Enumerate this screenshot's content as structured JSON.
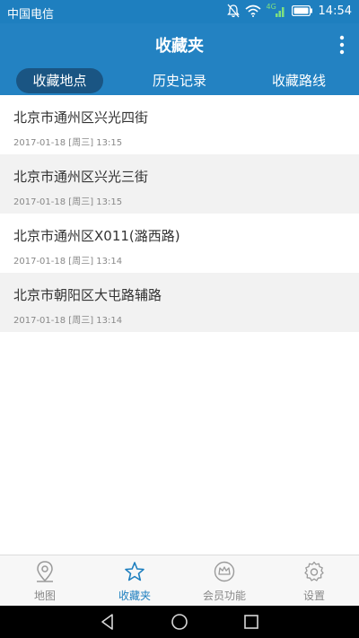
{
  "status_bar": {
    "carrier": "中国电信",
    "time": "14:54",
    "signal_label": "4G",
    "icons": [
      "notification-off-icon",
      "wifi-icon",
      "signal-icon",
      "battery-icon"
    ]
  },
  "header": {
    "title": "收藏夹",
    "tabs": [
      {
        "label": "收藏地点",
        "active": true
      },
      {
        "label": "历史记录",
        "active": false
      },
      {
        "label": "收藏路线",
        "active": false
      }
    ]
  },
  "favorites": [
    {
      "address": "北京市通州区兴光四街",
      "time": "2017-01-18 [周三] 13:15"
    },
    {
      "address": "北京市通州区兴光三街",
      "time": "2017-01-18 [周三] 13:15"
    },
    {
      "address": "北京市通州区X011(潞西路)",
      "time": "2017-01-18 [周三] 13:14"
    },
    {
      "address": "北京市朝阳区大屯路辅路",
      "time": "2017-01-18 [周三] 13:14"
    }
  ],
  "bottom_nav": {
    "items": [
      {
        "label": "地图",
        "icon": "location-pin-icon",
        "active": false
      },
      {
        "label": "收藏夹",
        "icon": "star-icon",
        "active": true
      },
      {
        "label": "会员功能",
        "icon": "crown-icon",
        "active": false
      },
      {
        "label": "设置",
        "icon": "gear-icon",
        "active": false
      }
    ]
  },
  "colors": {
    "primary": "#2382c2",
    "status_bar": "#1e7fbf",
    "active_tab_bg": "#2c4f6b",
    "active_nav": "#1e7fbf",
    "inactive_nav": "#888888"
  }
}
